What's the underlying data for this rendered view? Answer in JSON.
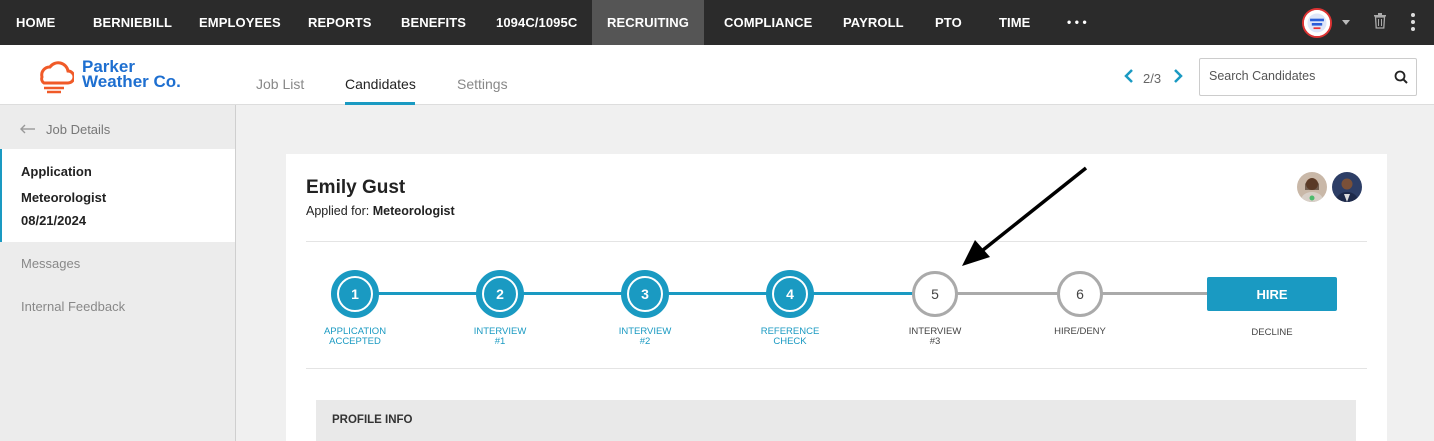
{
  "nav": {
    "items": [
      "HOME",
      "BERNIEBILL",
      "EMPLOYEES",
      "REPORTS",
      "BENEFITS",
      "1094C/1095C",
      "RECRUITING",
      "COMPLIANCE",
      "PAYROLL",
      "PTO",
      "TIME"
    ],
    "more": "• • •",
    "active": "RECRUITING"
  },
  "brand": {
    "line1": "Parker",
    "line2": "Weather Co.",
    "color": "#1e6fd0",
    "icon_color": "#f05a28"
  },
  "tabs": [
    "Job List",
    "Candidates",
    "Settings"
  ],
  "active_tab": "Candidates",
  "pager": {
    "text": "2/3"
  },
  "search": {
    "placeholder": "Search Candidates"
  },
  "sidebar": {
    "back_label": "Job Details",
    "card": {
      "title": "Application",
      "job": "Meteorologist",
      "date": "08/21/2024"
    },
    "links": [
      "Messages",
      "Internal Feedback"
    ]
  },
  "candidate": {
    "name": "Emily Gust",
    "applied_prefix": "Applied for:",
    "applied_job": "Meteorologist"
  },
  "steps": [
    {
      "num": "1",
      "label1": "APPLICATION",
      "label2": "ACCEPTED",
      "done": true
    },
    {
      "num": "2",
      "label1": "INTERVIEW",
      "label2": "#1",
      "done": true
    },
    {
      "num": "3",
      "label1": "INTERVIEW",
      "label2": "#2",
      "done": true
    },
    {
      "num": "4",
      "label1": "REFERENCE",
      "label2": "CHECK",
      "done": true
    },
    {
      "num": "5",
      "label1": "INTERVIEW",
      "label2": "#3",
      "done": false
    },
    {
      "num": "6",
      "label1": "HIRE/DENY",
      "label2": "",
      "done": false
    }
  ],
  "actions": {
    "hire": "HIRE",
    "decline": "DECLINE"
  },
  "profile_section": "PROFILE INFO",
  "colors": {
    "accent": "#1a9ac2",
    "nav_bg": "#2b2b2b",
    "nav_active": "#555555"
  }
}
